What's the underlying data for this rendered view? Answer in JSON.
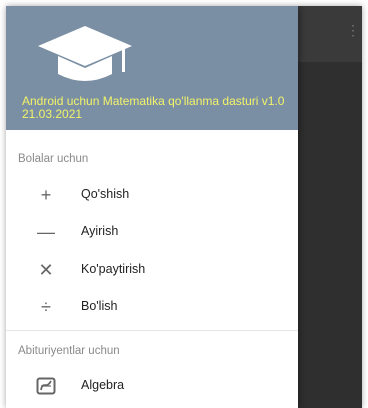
{
  "app_bar": {
    "overflow_icon": "more-vert-icon"
  },
  "drawer": {
    "header": {
      "icon": "graduation-cap-icon",
      "title": "Android uchun Matematika qo'llanma dasturi v1.0 21.03.2021",
      "background_color": "#7a8fa3",
      "title_color": "#f3f36a"
    },
    "sections": [
      {
        "label": "Bolalar uchun",
        "items": [
          {
            "icon": "plus-icon",
            "label": "Qo'shish"
          },
          {
            "icon": "minus-icon",
            "label": "Ayirish"
          },
          {
            "icon": "multiply-icon",
            "label": "Ko'paytirish"
          },
          {
            "icon": "divide-icon",
            "label": "Bo'lish"
          }
        ]
      },
      {
        "label": "Abituriyentlar uchun",
        "items": [
          {
            "icon": "function-graph-icon",
            "label": "Algebra"
          }
        ]
      }
    ]
  }
}
